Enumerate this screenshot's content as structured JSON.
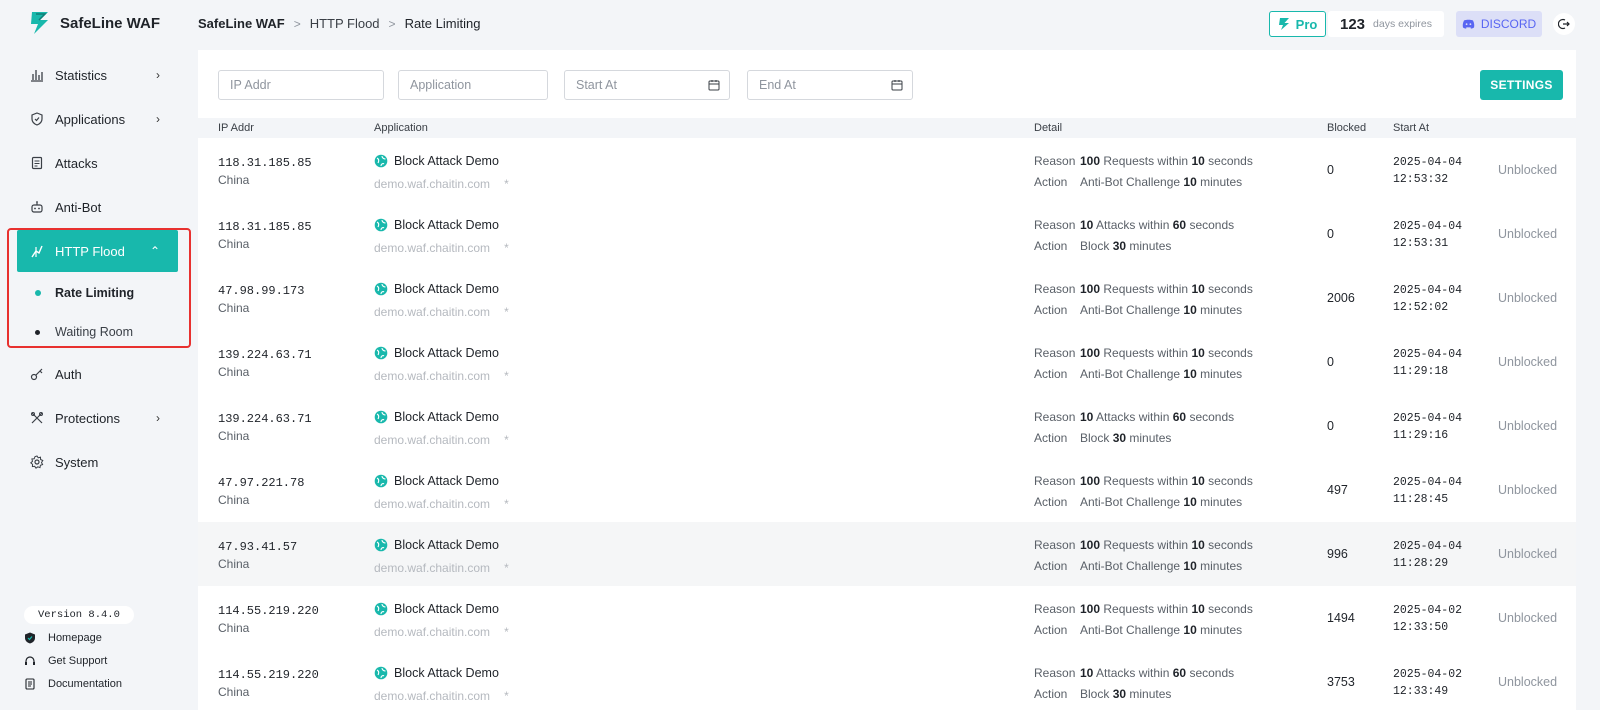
{
  "app": {
    "name": "SafeLine WAF",
    "version": "Version 8.4.0"
  },
  "sidebar": {
    "items": [
      {
        "label": "Statistics",
        "icon": "bar-chart-icon",
        "chevron": "›"
      },
      {
        "label": "Applications",
        "icon": "shield-icon",
        "chevron": "›"
      },
      {
        "label": "Attacks",
        "icon": "clipboard-icon",
        "chevron": ""
      },
      {
        "label": "Anti-Bot",
        "icon": "robot-icon",
        "chevron": ""
      },
      {
        "label": "HTTP Flood",
        "icon": "flood-icon",
        "chevron": "‹"
      },
      {
        "label": "Auth",
        "icon": "key-icon",
        "chevron": ""
      },
      {
        "label": "Protections",
        "icon": "tools-icon",
        "chevron": "›"
      },
      {
        "label": "System",
        "icon": "gear-icon",
        "chevron": ""
      }
    ],
    "subitems": [
      {
        "label": "Rate Limiting"
      },
      {
        "label": "Waiting Room"
      }
    ],
    "footer": {
      "homepage": "Homepage",
      "support": "Get Support",
      "docs": "Documentation"
    }
  },
  "header": {
    "breadcrumb": [
      "SafeLine WAF",
      "HTTP Flood",
      "Rate Limiting"
    ],
    "pro": "Pro",
    "days_num": "123",
    "days_label": "days expires",
    "discord": "DISCORD"
  },
  "filters": {
    "ip_placeholder": "IP Addr",
    "app_placeholder": "Application",
    "start_placeholder": "Start At",
    "end_placeholder": "End At",
    "settings": "SETTINGS"
  },
  "table": {
    "headers": {
      "ip": "IP Addr",
      "application": "Application",
      "detail": "Detail",
      "blocked": "Blocked",
      "start": "Start At"
    },
    "labels": {
      "reason": "Reason",
      "action": "Action",
      "requests_within": "Requests within",
      "attacks_within": "Attacks within",
      "seconds": "seconds",
      "minutes": "minutes",
      "challenge": "Anti-Bot Challenge",
      "block": "Block"
    },
    "rows": [
      {
        "ip": "118.31.185.85",
        "country": "China",
        "app": "Block Attack Demo",
        "domain": "demo.waf.chaitin.com",
        "star": "*",
        "count": "100",
        "kind": "Requests within",
        "secs": "10",
        "act": "Anti-Bot Challenge",
        "mins": "10",
        "blocked": "0",
        "date": "2025-04-04",
        "time": "12:53:32",
        "status": "Unblocked"
      },
      {
        "ip": "118.31.185.85",
        "country": "China",
        "app": "Block Attack Demo",
        "domain": "demo.waf.chaitin.com",
        "star": "*",
        "count": "10",
        "kind": "Attacks within",
        "secs": "60",
        "act": "Block",
        "mins": "30",
        "blocked": "0",
        "date": "2025-04-04",
        "time": "12:53:31",
        "status": "Unblocked"
      },
      {
        "ip": "47.98.99.173",
        "country": "China",
        "app": "Block Attack Demo",
        "domain": "demo.waf.chaitin.com",
        "star": "*",
        "count": "100",
        "kind": "Requests within",
        "secs": "10",
        "act": "Anti-Bot Challenge",
        "mins": "10",
        "blocked": "2006",
        "date": "2025-04-04",
        "time": "12:52:02",
        "status": "Unblocked"
      },
      {
        "ip": "139.224.63.71",
        "country": "China",
        "app": "Block Attack Demo",
        "domain": "demo.waf.chaitin.com",
        "star": "*",
        "count": "100",
        "kind": "Requests within",
        "secs": "10",
        "act": "Anti-Bot Challenge",
        "mins": "10",
        "blocked": "0",
        "date": "2025-04-04",
        "time": "11:29:18",
        "status": "Unblocked"
      },
      {
        "ip": "139.224.63.71",
        "country": "China",
        "app": "Block Attack Demo",
        "domain": "demo.waf.chaitin.com",
        "star": "*",
        "count": "10",
        "kind": "Attacks within",
        "secs": "60",
        "act": "Block",
        "mins": "30",
        "blocked": "0",
        "date": "2025-04-04",
        "time": "11:29:16",
        "status": "Unblocked"
      },
      {
        "ip": "47.97.221.78",
        "country": "China",
        "app": "Block Attack Demo",
        "domain": "demo.waf.chaitin.com",
        "star": "*",
        "count": "100",
        "kind": "Requests within",
        "secs": "10",
        "act": "Anti-Bot Challenge",
        "mins": "10",
        "blocked": "497",
        "date": "2025-04-04",
        "time": "11:28:45",
        "status": "Unblocked"
      },
      {
        "ip": "47.93.41.57",
        "country": "China",
        "app": "Block Attack Demo",
        "domain": "demo.waf.chaitin.com",
        "star": "*",
        "count": "100",
        "kind": "Requests within",
        "secs": "10",
        "act": "Anti-Bot Challenge",
        "mins": "10",
        "blocked": "996",
        "date": "2025-04-04",
        "time": "11:28:29",
        "status": "Unblocked"
      },
      {
        "ip": "114.55.219.220",
        "country": "China",
        "app": "Block Attack Demo",
        "domain": "demo.waf.chaitin.com",
        "star": "*",
        "count": "100",
        "kind": "Requests within",
        "secs": "10",
        "act": "Anti-Bot Challenge",
        "mins": "10",
        "blocked": "1494",
        "date": "2025-04-02",
        "time": "12:33:50",
        "status": "Unblocked"
      },
      {
        "ip": "114.55.219.220",
        "country": "China",
        "app": "Block Attack Demo",
        "domain": "demo.waf.chaitin.com",
        "star": "*",
        "count": "10",
        "kind": "Attacks within",
        "secs": "60",
        "act": "Block",
        "mins": "30",
        "blocked": "3753",
        "date": "2025-04-02",
        "time": "12:33:49",
        "status": "Unblocked"
      }
    ]
  },
  "colors": {
    "accent": "#18b8ac",
    "highlight": "#e8312f",
    "discord": "#5865f2"
  }
}
